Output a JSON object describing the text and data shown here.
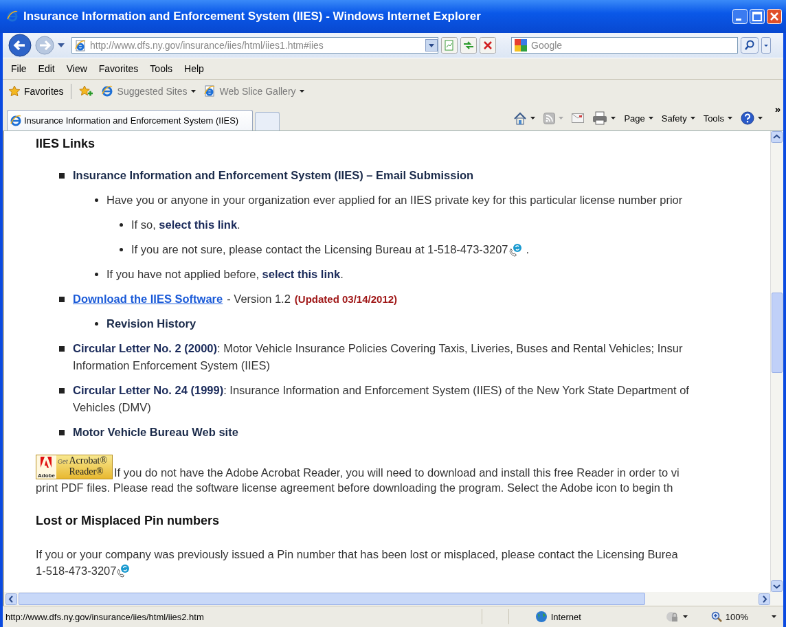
{
  "window": {
    "title": "Insurance Information and Enforcement System (IIES) - Windows Internet Explorer"
  },
  "address_bar": {
    "value": "http://www.dfs.ny.gov/insurance/iies/html/iies1.htm#iies",
    "search_placeholder": "Google"
  },
  "menu": [
    "File",
    "Edit",
    "View",
    "Favorites",
    "Tools",
    "Help"
  ],
  "favorites_bar": {
    "label": "Favorites",
    "items": [
      "Suggested Sites",
      "Web Slice Gallery"
    ]
  },
  "tabs": [
    {
      "label": "Insurance Information and Enforcement System (IIES)",
      "selected": true
    }
  ],
  "command_bar": {
    "menus": [
      "Page",
      "Safety",
      "Tools"
    ],
    "more": "»"
  },
  "content": {
    "heading": "IIES Links",
    "links": [
      {
        "title": "Insurance Information and Enforcement System (IIES) – Email Submission",
        "children": [
          {
            "text": "Have you or anyone in your organization ever applied for an IIES private key for this particular license number prior",
            "children": [
              {
                "text": "If so, **select this link**."
              },
              {
                "text": "If you are not sure, please contact the Licensing Bureau at 1-518-473-3207",
                "phone": true,
                "after": "."
              }
            ]
          },
          {
            "text": "If you have not applied before, **select this link**."
          }
        ]
      },
      {
        "link": "Download the IIES Software",
        "text": "- Version 1.2",
        "note": "(Updated 03/14/2012)",
        "children": [
          {
            "title": "Revision History"
          }
        ]
      },
      {
        "lines": [
          "**Circular Letter No. 2 (2000)**: Motor Vehicle Insurance Policies Covering Taxis, Liveries, Buses and Rental Vehicles; Insur",
          "Information Enforcement System (IIES)"
        ]
      },
      {
        "lines": [
          "**Circular Letter No. 24 (1999)**: Insurance Information and Enforcement System (IIES) of the New York State Department of",
          "Vehicles (DMV)"
        ]
      },
      {
        "title": "Motor Vehicle Bureau Web site"
      }
    ],
    "acrobat_badge": {
      "get": "Get",
      "product": "Acrobat®",
      "product2": "Reader®",
      "brand": "Adobe"
    },
    "acrobat_text": [
      "If you do not have the Adobe Acrobat Reader, you will need to download and install this free Reader in order to vi",
      "print PDF files. Please read the software license agreement before downloading the program. Select the Adobe icon to begin th"
    ],
    "section_heading": "Lost or Misplaced Pin numbers",
    "pin_text": [
      "If you or your company was previously issued a Pin number that has been lost or misplaced, please contact the Licensing Burea"
    ],
    "pin_phone": "1-518-473-3207"
  },
  "status_bar": {
    "url": "http://www.dfs.ny.gov/insurance/iies/html/iies2.htm",
    "zone": "Internet",
    "zoom": "100%"
  }
}
